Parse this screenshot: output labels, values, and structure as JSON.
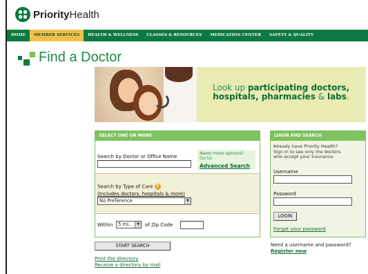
{
  "logo": {
    "brand_bold": "Priority",
    "brand_light": "Health"
  },
  "nav": {
    "items": [
      "HOME",
      "MEMBER SERVICES",
      "HEALTH & WELLNESS",
      "CLASSES & RESOURCES",
      "MEDICATION CENTER",
      "SAFETY & QUALITY"
    ],
    "active_index": 1
  },
  "page": {
    "title": "Find a Doctor"
  },
  "banner": {
    "line1_prefix": "Look up ",
    "line1_bold": "participating doctors,",
    "line2_part1": "hospitals, ",
    "line2_part2": "pharmacies",
    "line2_amp": " & ",
    "line2_part3": "labs",
    "line2_end": "."
  },
  "search": {
    "heading": "SELECT ONE OR MORE",
    "name_label": "Search by Doctor or Office Name",
    "more_options_line1": "Need more options?",
    "more_options_line2": "Go to:",
    "advanced_link": "Advanced Search",
    "care_label": "Search by Type of Care",
    "care_sublabel": "(Includes doctors, hospitals & more)",
    "care_selected": "No Preference",
    "within_label": "Within",
    "distance_selected": "5 mi.",
    "zip_label": "of Zip Code",
    "start_button": "START SEARCH",
    "print_link": "Print the directory",
    "mail_link": "Receive a directory by mail"
  },
  "login": {
    "heading": "LOGIN AND SEARCH",
    "intro_1": "Already have Priority Health?",
    "intro_2": "Sign in to see only the doctors",
    "intro_3": "who accept your insurance.",
    "username_label": "Username",
    "password_label": "Password",
    "login_button": "LOGIN",
    "forgot_link": "Forgot your password",
    "need_text": "Need a username and password?",
    "register_link": "Register now"
  },
  "colors": {
    "nav_green": "#0c7a40",
    "nav_active": "#efc14a",
    "panel_header": "#7fc35e",
    "title_green": "#1a8a49"
  }
}
